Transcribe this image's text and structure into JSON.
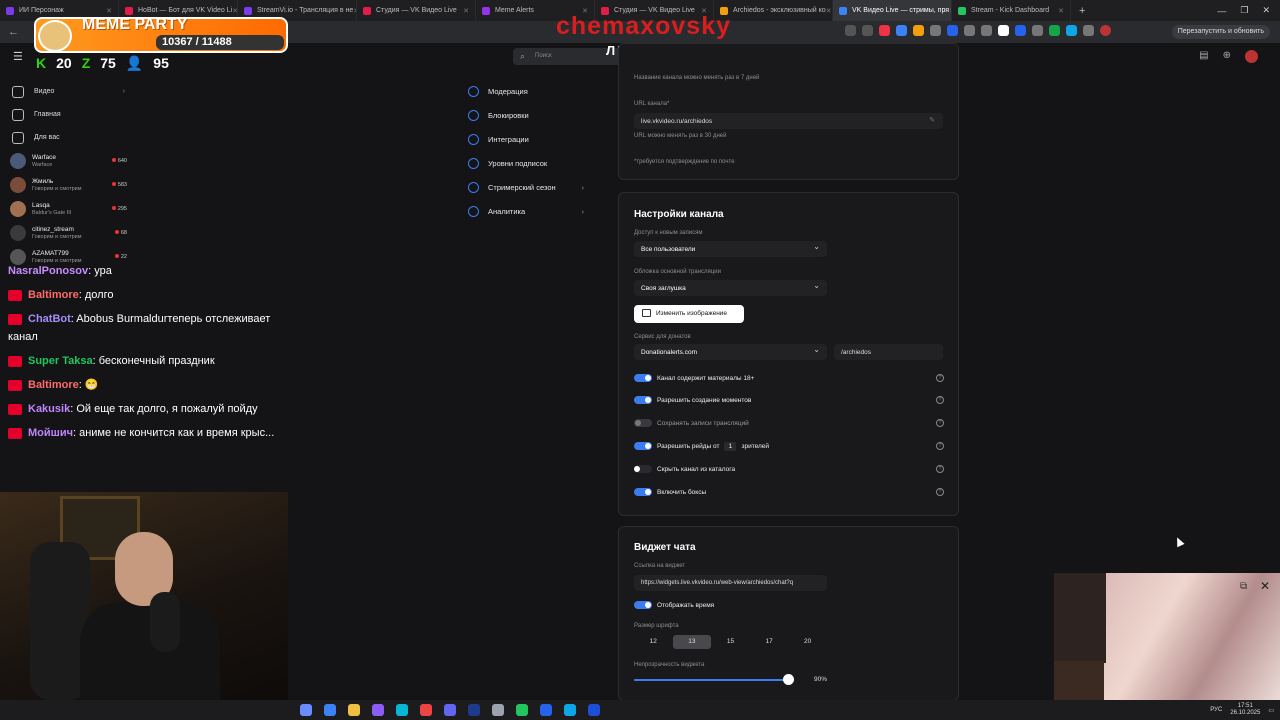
{
  "browser": {
    "tabs": [
      {
        "label": "ИИ Персонаж",
        "color": "#7c3aed"
      },
      {
        "label": "HoBot — Бот для VK Video Li",
        "color": "#e11d48"
      },
      {
        "label": "StreamVi.io - Трансляция в не",
        "color": "#7c3aed"
      },
      {
        "label": "Студия — VK Видео Live",
        "color": "#e11d48"
      },
      {
        "label": "Meme Alerts",
        "color": "#9333ea"
      },
      {
        "label": "Студия — VK Видео Live",
        "color": "#e11d48"
      },
      {
        "label": "Archiedos - эксклюзивный ко",
        "color": "#f59e0b"
      },
      {
        "label": "VK Видео Live — стримы, пря",
        "color": "#3b82f6"
      },
      {
        "label": "Stream - Kick Dashboard",
        "color": "#22c55e"
      }
    ],
    "restart_label": "Перезапустить и обновить"
  },
  "overlay": {
    "meme_title": "MEME PARTY",
    "progress": "10367 / 11488",
    "brand": "chemaxovsky",
    "subtitle": "ЛЕГЕНДА",
    "stats": [
      {
        "value": "20"
      },
      {
        "value": "75"
      },
      {
        "value": "95"
      }
    ]
  },
  "search": {
    "placeholder": "Поиск"
  },
  "sidebar": {
    "nav": [
      {
        "label": "Видео"
      },
      {
        "label": "Главная"
      },
      {
        "label": "Для вас"
      }
    ],
    "channels": [
      {
        "name": "Warface",
        "sub": "Warface",
        "viewers": "640",
        "color": "#4a5a78"
      },
      {
        "name": "Жмиль",
        "sub": "Говорим и смотрим",
        "viewers": "583",
        "color": "#7a4d3a"
      },
      {
        "name": "Lasqa",
        "sub": "Baldur's Gate III",
        "viewers": "295",
        "color": "#a07050"
      },
      {
        "name": "citinez_stream",
        "sub": "Говорим и смотрим",
        "viewers": "68",
        "color": "#3a3a3a"
      },
      {
        "name": "AZAMAT799",
        "sub": "Говорим и смотрим",
        "viewers": "22",
        "color": "#555"
      }
    ]
  },
  "chat": [
    {
      "user": "NasralPonosov",
      "color": "#c68cff",
      "text": "ура"
    },
    {
      "user": "Baltimore",
      "color": "#ff6a6a",
      "text": "долго"
    },
    {
      "user": "ChatBot",
      "color": "#a78bfa",
      "text": "Abobus Burmaldurтеперь отслеживает канал"
    },
    {
      "user": "Super Taksa",
      "color": "#22c55e",
      "text": "бесконечный праздник"
    },
    {
      "user": "Baltimore",
      "color": "#ff6a6a",
      "text": "😁"
    },
    {
      "user": "Kakusik",
      "color": "#c084fc",
      "text": "Ой еще так долго, я пожалуй пойду"
    },
    {
      "user": "Moйшич",
      "color": "#c084fc",
      "text": "аниме не кончится как и время крыс..."
    }
  ],
  "settings_nav": [
    {
      "label": "Модерация"
    },
    {
      "label": "Блокировки"
    },
    {
      "label": "Интеграции"
    },
    {
      "label": "Уровни подписок"
    },
    {
      "label": "Стримерский сезон"
    },
    {
      "label": "Аналитика"
    }
  ],
  "channel_card": {
    "name_hint": "Название канала можно менять раз в 7 дней",
    "url_label": "URL канала*",
    "url_value": "live.vkvideo.ru/archiedos",
    "url_hint": "URL можно менять раз в 30 дней",
    "required_hint": "*требуется подтверждение по почте"
  },
  "settings": {
    "title": "Настройки канала",
    "access_label": "Доступ к новым записям",
    "access_value": "Все пользователи",
    "cover_label": "Обложка основной трансляции",
    "cover_value": "Своя заглушка",
    "change_image": "Изменить изображение",
    "donation_label": "Сервис для донатов",
    "donation_value": "Donationalerts.com",
    "donation_handle": "/archiedos",
    "toggles": [
      {
        "label": "Канал содержит материалы 18+",
        "on": true
      },
      {
        "label": "Разрешить создание моментов",
        "on": true
      },
      {
        "label": "Сохранять записи трансляций",
        "on": false
      },
      {
        "label_pre": "Разрешить рейды от",
        "num": "1",
        "label_post": "зрителей",
        "on": true
      },
      {
        "label": "Скрыть канал из каталога",
        "on": false
      },
      {
        "label": "Включить боксы",
        "on": true
      }
    ]
  },
  "widget": {
    "title": "Виджет чата",
    "link_label": "Ссылка на виджет",
    "link_value": "https://widgets.live.vkvideo.ru/web-view/archiedos/chat?q",
    "show_time": "Отображать время",
    "font_label": "Размер шрифта",
    "sizes": [
      "12",
      "13",
      "15",
      "17",
      "20"
    ],
    "selected_size": "13",
    "opacity_label": "Непрозрачность виджета",
    "opacity": "90%",
    "opacity_value": 0.9
  },
  "taskbar": {
    "lang": "РУС",
    "time": "17:51",
    "date": "26.10.2025"
  }
}
